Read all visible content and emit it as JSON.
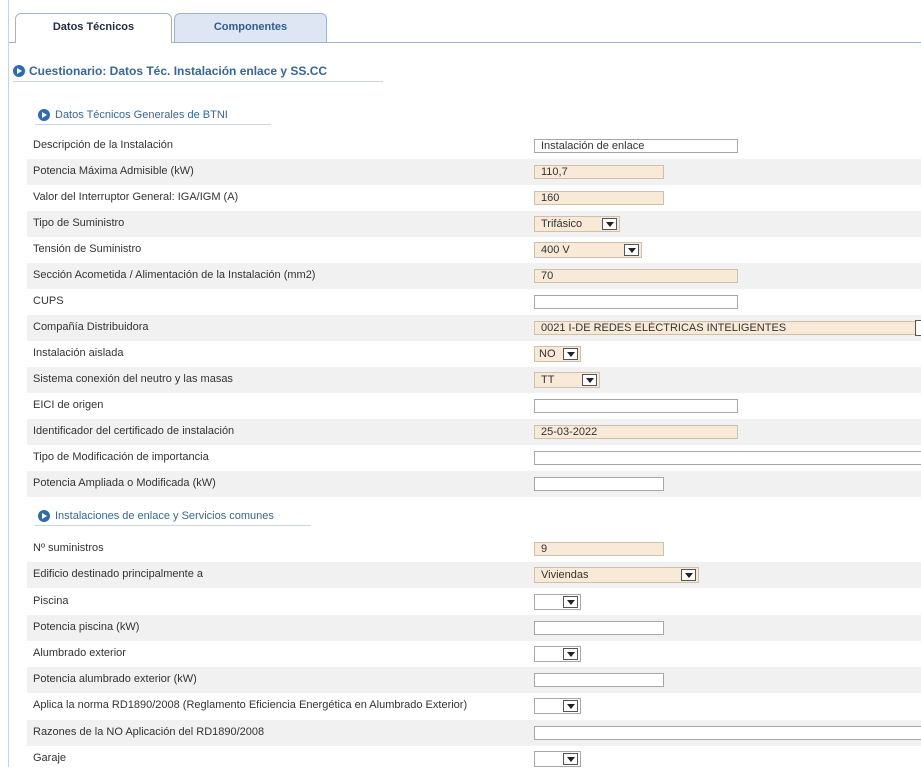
{
  "tabs": [
    {
      "label": "Datos Técnicos",
      "active": true
    },
    {
      "label": "Componentes",
      "active": false
    }
  ],
  "questionnaire_title": "Cuestionario: Datos Téc. Instalación enlace y SS.CC",
  "sections": [
    {
      "title": "Datos Técnicos Generales de BTNI"
    },
    {
      "title": "Instalaciones de enlace y Servicios comunes"
    }
  ],
  "fields": {
    "descripcion": {
      "label": "Descripción de la Instalación",
      "value": "Instalación de enlace"
    },
    "potencia_max": {
      "label": "Potencia Máxima Admisible (kW)",
      "value": "110,7"
    },
    "interruptor": {
      "label": "Valor del Interruptor General: IGA/IGM (A)",
      "value": "160"
    },
    "tipo_suministro": {
      "label": "Tipo de Suministro",
      "value": "Trifásico"
    },
    "tension": {
      "label": "Tensión de Suministro",
      "value": "400 V"
    },
    "seccion": {
      "label": "Sección Acometida / Alimentación de la Instalación (mm2)",
      "value": "70"
    },
    "cups": {
      "label": "CUPS",
      "value": ""
    },
    "compania": {
      "label": "Compañía Distribuidora",
      "value": "0021 I-DE REDES ELÉCTRICAS INTELIGENTES"
    },
    "aislada": {
      "label": "Instalación aislada",
      "value": "NO"
    },
    "sistema_neutro": {
      "label": "Sistema conexión del neutro y las masas",
      "value": "TT"
    },
    "eici": {
      "label": "EICI de origen",
      "value": ""
    },
    "identificador": {
      "label": "Identificador del certificado de instalación",
      "value": "25-03-2022"
    },
    "tipo_modificacion": {
      "label": "Tipo de Modificación de importancia",
      "value": ""
    },
    "potencia_ampliada": {
      "label": "Potencia Ampliada o Modificada (kW)",
      "value": ""
    },
    "n_suministros": {
      "label": "Nº suministros",
      "value": "9"
    },
    "edificio": {
      "label": "Edificio destinado principalmente a",
      "value": "Viviendas"
    },
    "piscina": {
      "label": "Piscina",
      "value": ""
    },
    "potencia_piscina": {
      "label": "Potencia piscina (kW)",
      "value": ""
    },
    "alumbrado": {
      "label": "Alumbrado exterior",
      "value": ""
    },
    "potencia_alumbrado": {
      "label": "Potencia alumbrado exterior (kW)",
      "value": ""
    },
    "aplica_norma": {
      "label": "Aplica la norma RD1890/2008 (Reglamento Eficiencia Energética en Alumbrado Exterior)",
      "value": ""
    },
    "razones": {
      "label": "Razones de la NO Aplicación del RD1890/2008",
      "value": ""
    },
    "garaje": {
      "label": "Garaje",
      "value": ""
    }
  },
  "icons": {
    "section": "circle-arrow-right-icon",
    "dropdown": "chevron-down-icon"
  },
  "colors": {
    "readonly_fill": "#f8ead7",
    "accent": "#35679a",
    "row_shade": "#f1f1f1"
  }
}
